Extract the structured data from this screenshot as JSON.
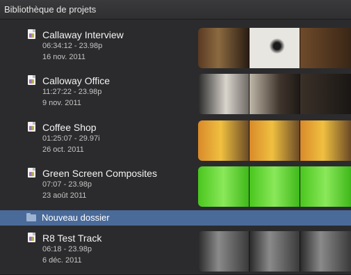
{
  "window": {
    "title": "Bibliothèque de projets"
  },
  "projects": [
    {
      "name": "Callaway Interview",
      "timecode": "06:34:12 - 23.98p",
      "date": "16 nov. 2011"
    },
    {
      "name": "Calloway Office",
      "timecode": "11:27:22 - 23.98p",
      "date": "9 nov. 2011"
    },
    {
      "name": "Coffee Shop",
      "timecode": "01:25:07 - 29.97i",
      "date": "26 oct. 2011"
    },
    {
      "name": "Green Screen Composites",
      "timecode": "07:07 - 23.98p",
      "date": "23 août 2011"
    }
  ],
  "folder": {
    "label": "Nouveau dossier"
  },
  "projects_after_folder": [
    {
      "name": "R8 Test Track",
      "timecode": "06:18 - 23.98p",
      "date": "6 déc. 2011"
    }
  ]
}
